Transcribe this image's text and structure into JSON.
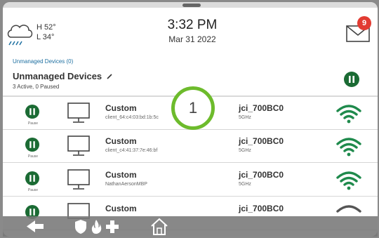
{
  "header": {
    "weather": {
      "icon": "cloud-rain-icon",
      "high": "H 52°",
      "low": "L 34°"
    },
    "time": "3:32 PM",
    "date": "Mar 31 2022",
    "mail": {
      "icon": "envelope-icon",
      "badge": "9"
    }
  },
  "breadcrumb": "Unmanaged Devices (0)",
  "section": {
    "title": "Unmanaged Devices",
    "title_icon": "pencil-icon",
    "subtitle": "3 Active, 0 Paused",
    "pause_all_icon": "pause-icon"
  },
  "callout": "1",
  "devices": [
    {
      "pause_label": "Pause",
      "name": "Custom",
      "id": "client_64:c4:03:bd:1b:5c",
      "ssid": "jci_700BC0",
      "band": "5GHz"
    },
    {
      "pause_label": "Pause",
      "name": "Custom",
      "id": "client_c4:41:37:7e:46:bf",
      "ssid": "jci_700BC0",
      "band": "5GHz"
    },
    {
      "pause_label": "Pause",
      "name": "Custom",
      "id": "NathanAersonMBP",
      "ssid": "jci_700BC0",
      "band": "5GHz"
    },
    {
      "pause_label": "",
      "name": "Custom",
      "id": "",
      "ssid": "jci_700BC0",
      "band": ""
    }
  ],
  "colors": {
    "accent": "#1b6b34",
    "wifi": "#1f8a4c",
    "callout": "#6dbb2c",
    "badge": "#e23b32"
  },
  "bottom_nav": [
    "back-arrow-icon",
    "shield-icon",
    "flame-icon",
    "plus-icon",
    "home-icon"
  ]
}
